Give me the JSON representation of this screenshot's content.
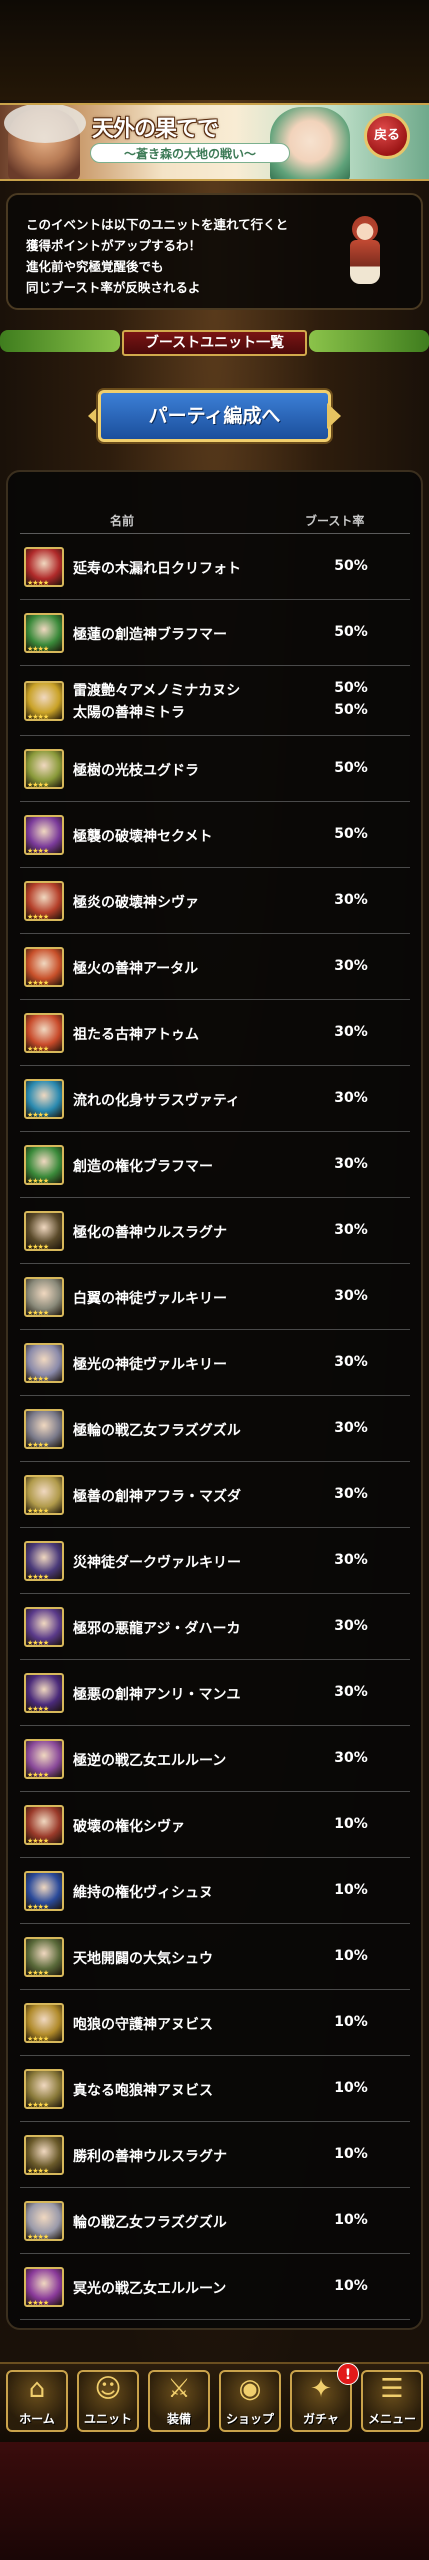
{
  "banner": {
    "title": "天外の果てで",
    "subtitle": "〜蒼き森の大地の戦い〜",
    "back_label": "戻る"
  },
  "info": {
    "text": "このイベントは以下のユニットを連れて行くと\n獲得ポイントがアップするわ！\n進化前や究極覚醒後でも\n同じブースト率が反映されるよ"
  },
  "section": {
    "title": "ブーストユニット一覧",
    "party_button": "パーティ編成へ"
  },
  "table": {
    "col_name": "名前",
    "col_rate": "ブースト率",
    "rows": [
      {
        "name": "延寿の木漏れ日クリフォト",
        "rate": "50%",
        "color": "#b02a2a"
      },
      {
        "name": "極蓮の創造神ブラフマー",
        "rate": "50%",
        "color": "#3a8a3a"
      },
      {
        "name": "雷渡艶々アメノミナカヌシ",
        "rate": "50%",
        "name2": "太陽の善神ミトラ",
        "rate2": "50%",
        "color": "#c9a227"
      },
      {
        "name": "極樹の光枝ユグドラ",
        "rate": "50%",
        "color": "#8a9a3a"
      },
      {
        "name": "極襲の破壊神セクメト",
        "rate": "50%",
        "color": "#7a3a9a"
      },
      {
        "name": "極炎の破壊神シヴァ",
        "rate": "30%",
        "color": "#b5402a"
      },
      {
        "name": "極火の善神アータル",
        "rate": "30%",
        "color": "#c8502a"
      },
      {
        "name": "祖たる古神アトゥム",
        "rate": "30%",
        "color": "#c84a2a"
      },
      {
        "name": "流れの化身サラスヴァティ",
        "rate": "30%",
        "color": "#2a8ab0"
      },
      {
        "name": "創造の権化ブラフマー",
        "rate": "30%",
        "color": "#3a8a3a"
      },
      {
        "name": "極化の善神ウルスラグナ",
        "rate": "30%",
        "color": "#5a4a2a"
      },
      {
        "name": "白翼の神徒ヴァルキリー",
        "rate": "30%",
        "color": "#8a8a7a"
      },
      {
        "name": "極光の神徒ヴァルキリー",
        "rate": "30%",
        "color": "#8a8aaa"
      },
      {
        "name": "極輪の戦乙女フラズグズル",
        "rate": "30%",
        "color": "#7a7a8a"
      },
      {
        "name": "極善の創神アフラ・マズダ",
        "rate": "30%",
        "color": "#b09a4a"
      },
      {
        "name": "災神徒ダークヴァルキリー",
        "rate": "30%",
        "color": "#4a3a7a"
      },
      {
        "name": "極邪の悪龍アジ・ダハーカ",
        "rate": "30%",
        "color": "#5a3a8a"
      },
      {
        "name": "極悪の創神アンリ・マンユ",
        "rate": "30%",
        "color": "#4a2a7a"
      },
      {
        "name": "極逆の戦乙女エルルーン",
        "rate": "30%",
        "color": "#8a4a9a"
      },
      {
        "name": "破壊の権化シヴァ",
        "rate": "10%",
        "color": "#9a3a2a"
      },
      {
        "name": "維持の権化ヴィシュヌ",
        "rate": "10%",
        "color": "#2a4a9a"
      },
      {
        "name": "天地開闢の大気シュウ",
        "rate": "10%",
        "color": "#5a6a3a"
      },
      {
        "name": "咆狼の守護神アヌビス",
        "rate": "10%",
        "color": "#b08a2a"
      },
      {
        "name": "真なる咆狼神アヌビス",
        "rate": "10%",
        "color": "#8a7a3a"
      },
      {
        "name": "勝利の善神ウルスラグナ",
        "rate": "10%",
        "color": "#6a5a2a"
      },
      {
        "name": "輪の戦乙女フラズグズル",
        "rate": "10%",
        "color": "#9a9aaa"
      },
      {
        "name": "冥光の戦乙女エルルーン",
        "rate": "10%",
        "color": "#8a3a9a"
      }
    ]
  },
  "nav": {
    "items": [
      {
        "label": "ホーム",
        "icon": "home-icon",
        "glyph": "⌂"
      },
      {
        "label": "ユニット",
        "icon": "unit-icon",
        "glyph": "☺"
      },
      {
        "label": "装備",
        "icon": "equipment-icon",
        "glyph": "⚔"
      },
      {
        "label": "ショップ",
        "icon": "shop-icon",
        "glyph": "◉"
      },
      {
        "label": "ガチャ",
        "icon": "gacha-icon",
        "glyph": "✦"
      },
      {
        "label": "メニュー",
        "icon": "menu-icon",
        "glyph": "☰"
      }
    ],
    "gacha_badge": "!"
  }
}
